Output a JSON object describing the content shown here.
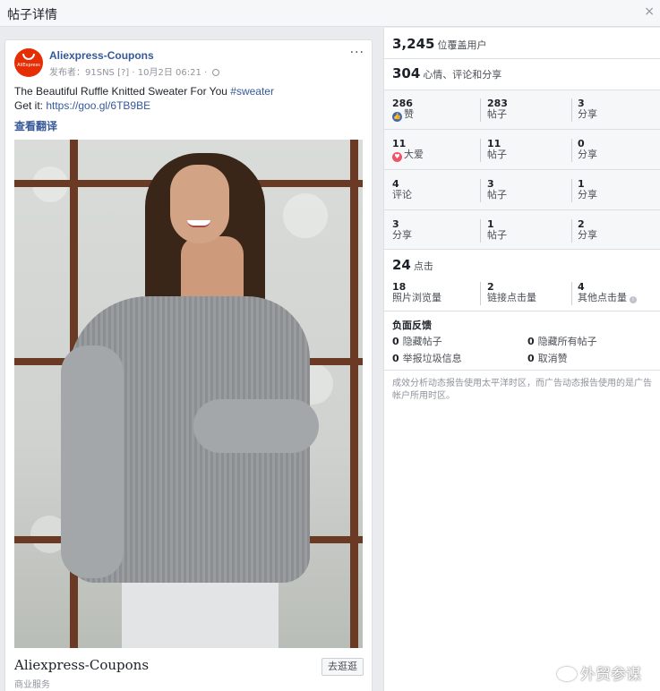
{
  "dialog": {
    "title": "帖子详情",
    "close": "×"
  },
  "post": {
    "page_name": "Aliexpress-Coupons",
    "avatar_brand": "AliExpress",
    "meta_prefix": "发布者：",
    "meta_publisher": "91SNS",
    "meta_badge": "[?]",
    "meta_date": "10月2日 06:21",
    "meta_sep": "·",
    "more": "···",
    "text_line1_prefix": "The Beautiful Ruffle Knitted Sweater For You ",
    "hashtag": "#sweater",
    "text_line2_prefix": "Get it: ",
    "link": "https://goo.gl/6TB9BE",
    "translate": "查看翻译"
  },
  "link_preview": {
    "title": "Aliexpress-Coupons",
    "subtitle": "商业服务",
    "button": "去逛逛"
  },
  "stats": {
    "reach_value": "3,245",
    "reach_label": "位覆盖用户",
    "engage_value": "304",
    "engage_label": "心情、评论和分享",
    "grid": [
      {
        "n": "286",
        "l": "赞"
      },
      {
        "n": "283",
        "l": "帖子"
      },
      {
        "n": "3",
        "l": "分享"
      },
      {
        "n": "11",
        "l": "大爱"
      },
      {
        "n": "11",
        "l": "帖子"
      },
      {
        "n": "0",
        "l": "分享"
      },
      {
        "n": "4",
        "l": "评论"
      },
      {
        "n": "3",
        "l": "帖子"
      },
      {
        "n": "1",
        "l": "分享"
      },
      {
        "n": "3",
        "l": "分享"
      },
      {
        "n": "1",
        "l": "帖子"
      },
      {
        "n": "2",
        "l": "分享"
      }
    ],
    "clicks_value": "24",
    "clicks_label": "点击",
    "clicks": [
      {
        "n": "18",
        "l": "照片浏览量"
      },
      {
        "n": "2",
        "l": "链接点击量"
      },
      {
        "n": "4",
        "l": "其他点击量"
      }
    ],
    "negative_title": "负面反馈",
    "negative": [
      {
        "n": "0",
        "l": "隐藏帖子"
      },
      {
        "n": "0",
        "l": "隐藏所有帖子"
      },
      {
        "n": "0",
        "l": "举报垃圾信息"
      },
      {
        "n": "0",
        "l": "取消赞"
      }
    ],
    "note": "成效分析动态报告使用太平洋时区，而广告动态报告使用的是广告帐户所用时区。"
  },
  "watermark": "外贸参谋"
}
